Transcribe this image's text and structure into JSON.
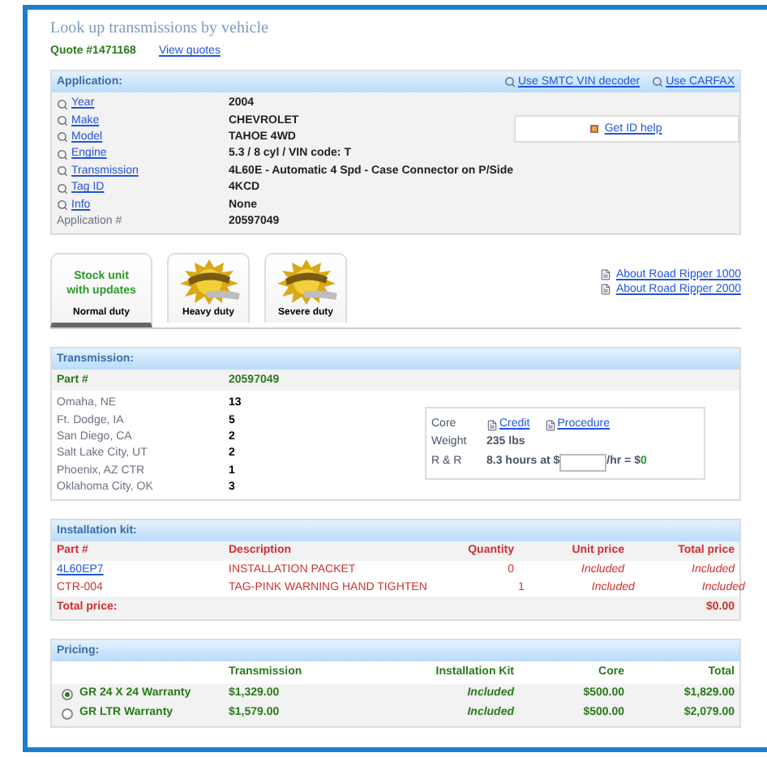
{
  "title": "Look up transmissions by vehicle",
  "quote": {
    "number": "Quote #1471168",
    "link": "View quotes"
  },
  "application": {
    "heading": "Application:",
    "header_links": [
      "Use SMTC VIN decoder",
      "Use CARFAX"
    ],
    "rows": [
      {
        "kind": "link",
        "label": "Year",
        "value": "2004"
      },
      {
        "kind": "link",
        "label": "Make",
        "value": "CHEVROLET"
      },
      {
        "kind": "link",
        "label": "Model",
        "value": "TAHOE 4WD"
      },
      {
        "kind": "link",
        "label": "Engine",
        "value": "5.3 / 8 cyl / VIN code: T"
      },
      {
        "kind": "link",
        "label": "Transmission",
        "value": "4L60E - Automatic 4 Spd - Case Connector on P/Side"
      },
      {
        "kind": "link",
        "label": "Tag ID",
        "value": "4KCD"
      },
      {
        "kind": "link",
        "label": "Info",
        "value": "None"
      },
      {
        "kind": "plain",
        "label": "Application #",
        "value": "20597049"
      }
    ],
    "help_link": "Get ID help"
  },
  "tabs": [
    {
      "kind": "text",
      "headline": "Stock unit with updates",
      "label": "Normal duty",
      "selected": true
    },
    {
      "kind": "logo",
      "label": "Heavy duty",
      "selected": false
    },
    {
      "kind": "logo",
      "label": "Severe duty",
      "selected": false
    }
  ],
  "about_links": [
    "About Road Ripper 1000",
    "About Road Ripper 2000"
  ],
  "transmission": {
    "heading": "Transmission:",
    "part_label": "Part #",
    "part_number": "20597049",
    "stock": [
      {
        "location": "Omaha, NE",
        "count": "13"
      },
      {
        "location": "Ft. Dodge, IA",
        "count": "5"
      },
      {
        "location": "San Diego, CA",
        "count": "2"
      },
      {
        "location": "Salt Lake City, UT",
        "count": "2"
      },
      {
        "location": "Phoenix, AZ CTR",
        "count": "1"
      },
      {
        "location": "Oklahoma City, OK",
        "count": "3"
      }
    ],
    "core_label": "Core",
    "core_links": [
      "Credit",
      "Procedure"
    ],
    "weight_label": "Weight",
    "weight": "235 lbs",
    "rr_label": "R & R",
    "rr_hours": "8.3 hours at $",
    "rr_rate": "/hr = $",
    "rr_total": "0"
  },
  "installation_kit": {
    "heading": "Installation kit:",
    "columns": [
      "Part #",
      "Description",
      "Quantity",
      "Unit price",
      "Total price"
    ],
    "rows": [
      {
        "kind": "link",
        "part": "4L60EP7",
        "description": "INSTALLATION PACKET",
        "quantity": "0",
        "unit_price": "Included",
        "total_price": "Included"
      },
      {
        "kind": "plain",
        "part": "CTR-004",
        "description": "TAG-PINK WARNING HAND TIGHTEN",
        "quantity": "1",
        "unit_price": "Included",
        "total_price": "Included"
      }
    ],
    "total_label": "Total price:",
    "total": "$0.00"
  },
  "pricing": {
    "heading": "Pricing:",
    "columns": [
      "Transmission",
      "Installation Kit",
      "Core",
      "Total"
    ],
    "rows": [
      {
        "name": "GR 24 X 24 Warranty",
        "selected": true,
        "transmission": "$1,329.00",
        "kit": "Included",
        "core": "$500.00",
        "total": "$1,829.00"
      },
      {
        "name": "GR LTR Warranty",
        "selected": false,
        "transmission": "$1,579.00",
        "kit": "Included",
        "core": "$500.00",
        "total": "$2,079.00"
      }
    ]
  }
}
